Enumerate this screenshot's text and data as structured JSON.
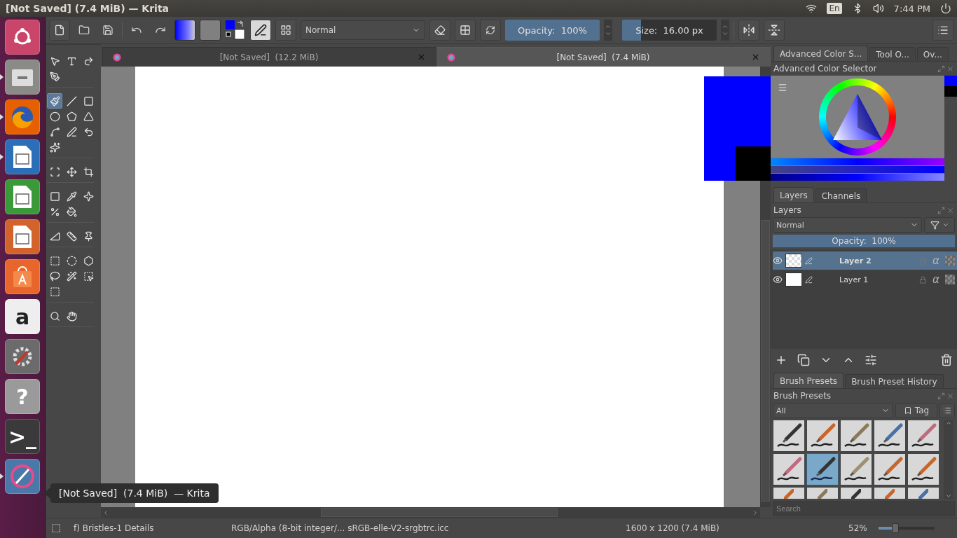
{
  "top_panel": {
    "title": "[Not Saved]  (7.4 MiB)  — Krita",
    "keyboard": "En",
    "time": "7:44 PM"
  },
  "launcher": [
    {
      "kind": "ubuntu",
      "color": "#c9466a",
      "running": false
    },
    {
      "kind": "files",
      "color": "#8a8a86",
      "running": true
    },
    {
      "kind": "firefox",
      "color": "#e66000",
      "running": true
    },
    {
      "kind": "writer",
      "color": "#2a6fb7",
      "running": true
    },
    {
      "kind": "calc",
      "color": "#3a9a3a",
      "running": false
    },
    {
      "kind": "impress",
      "color": "#d2632b",
      "running": false
    },
    {
      "kind": "store",
      "color": "#e8662c",
      "running": false
    },
    {
      "kind": "amazon",
      "color": "#eeeeee",
      "running": false,
      "glyph": "a"
    },
    {
      "kind": "settings",
      "color": "#6b6b6b",
      "running": false
    },
    {
      "kind": "help",
      "color": "#9a9a9a",
      "running": false,
      "glyph": "?"
    },
    {
      "kind": "terminal",
      "color": "#3a3a3a",
      "running": false,
      "glyph": ">_"
    },
    {
      "kind": "krita",
      "color": "#4a78a8",
      "running": true
    }
  ],
  "tooltip": "[Not Saved]  (7.4 MiB)  — Krita",
  "toolbar": {
    "blend_mode": "Normal",
    "opacity": {
      "label": "Opacity:  100%",
      "level": 1
    },
    "size": {
      "label": "Size:  16.00 px",
      "level": 0.2
    }
  },
  "toolbox": [
    [
      {
        "kind": "select",
        "selected": false
      },
      {
        "kind": "text",
        "selected": false
      },
      {
        "kind": "edit-shape",
        "selected": false
      },
      {
        "kind": "calligraphy",
        "selected": false
      }
    ],
    [
      {
        "kind": "brush",
        "selected": true
      },
      {
        "kind": "line",
        "selected": false
      },
      {
        "kind": "rectangle",
        "selected": false
      },
      {
        "kind": "ellipse",
        "selected": false
      },
      {
        "kind": "polygon",
        "selected": false
      },
      {
        "kind": "polyline",
        "selected": false
      },
      {
        "kind": "bezier",
        "selected": false
      },
      {
        "kind": "freehand-path",
        "selected": false
      },
      {
        "kind": "dynamic-brush",
        "selected": false
      },
      {
        "kind": "multibrush",
        "selected": false
      }
    ],
    [
      {
        "kind": "transform",
        "selected": false
      },
      {
        "kind": "move",
        "selected": false
      },
      {
        "kind": "crop",
        "selected": false
      }
    ],
    [
      {
        "kind": "gradient",
        "selected": false
      },
      {
        "kind": "picker",
        "selected": false
      },
      {
        "kind": "smart-patch",
        "selected": false
      },
      {
        "kind": "colorize",
        "selected": false
      },
      {
        "kind": "fill",
        "selected": false
      }
    ],
    [
      {
        "kind": "assistant",
        "selected": false
      },
      {
        "kind": "measure",
        "selected": false
      },
      {
        "kind": "pin",
        "selected": false
      }
    ],
    [
      {
        "kind": "rect-select",
        "selected": false
      },
      {
        "kind": "ellipse-select",
        "selected": false
      },
      {
        "kind": "polygon-select",
        "selected": false
      },
      {
        "kind": "lasso",
        "selected": false
      },
      {
        "kind": "wand",
        "selected": false
      },
      {
        "kind": "color-select",
        "selected": false
      },
      {
        "kind": "bezier-select",
        "selected": false
      }
    ],
    [
      {
        "kind": "zoom",
        "selected": false
      },
      {
        "kind": "pan",
        "selected": false
      }
    ]
  ],
  "document_tabs": [
    {
      "title": "[Not Saved]  (12.2 MiB)",
      "selected": false
    },
    {
      "title": "[Not Saved]  (7.4 MiB)",
      "selected": true
    }
  ],
  "color_docker": {
    "tabs": [
      {
        "label": "Advanced Color S...",
        "selected": true
      },
      {
        "label": "Tool O...",
        "selected": false
      },
      {
        "label": "Ov...",
        "selected": false
      }
    ],
    "title": "Advanced Color Selector"
  },
  "layers_docker": {
    "tabs": [
      {
        "label": "Layers",
        "selected": true
      },
      {
        "label": "Channels",
        "selected": false
      }
    ],
    "title": "Layers",
    "blend_mode": "Normal",
    "opacity": {
      "label": "Opacity:  100%",
      "level": 1
    },
    "layers": [
      {
        "name": "Layer 2",
        "selected": true,
        "visible": true,
        "alpha": "α",
        "transparent": true
      },
      {
        "name": "Layer 1",
        "selected": false,
        "visible": true,
        "alpha": "α",
        "transparent": false
      }
    ]
  },
  "brush_docker": {
    "tabs": [
      {
        "label": "Brush Presets",
        "selected": true
      },
      {
        "label": "Brush Preset History",
        "selected": false
      }
    ],
    "title": "Brush Presets",
    "filter": "All",
    "tag": "Tag",
    "search_placeholder": "Search",
    "presets": [
      {
        "kind": "pen",
        "selected": false
      },
      {
        "kind": "brush",
        "selected": false
      },
      {
        "kind": "ink",
        "selected": false
      },
      {
        "kind": "pencil",
        "selected": false
      },
      {
        "kind": "marker",
        "selected": false
      },
      {
        "kind": "marker",
        "selected": false
      },
      {
        "kind": "pen",
        "selected": true
      },
      {
        "kind": "bristles",
        "selected": false
      },
      {
        "kind": "brush",
        "selected": false
      },
      {
        "kind": "brush",
        "selected": false
      },
      {
        "kind": "brush",
        "selected": false
      },
      {
        "kind": "ink",
        "selected": false
      },
      {
        "kind": "pen",
        "selected": false
      },
      {
        "kind": "brush",
        "selected": false
      },
      {
        "kind": "pencil",
        "selected": false
      }
    ]
  },
  "status_bar": {
    "brush": "f) Bristles-1 Details",
    "color_space": "RGB/Alpha (8-bit integer/... sRGB-elle-V2-srgbtrc.icc",
    "image_size": "1600 x 1200 (7.4 MiB)",
    "zoom": "52%",
    "zoom_slider": {
      "level": 0.3
    }
  }
}
